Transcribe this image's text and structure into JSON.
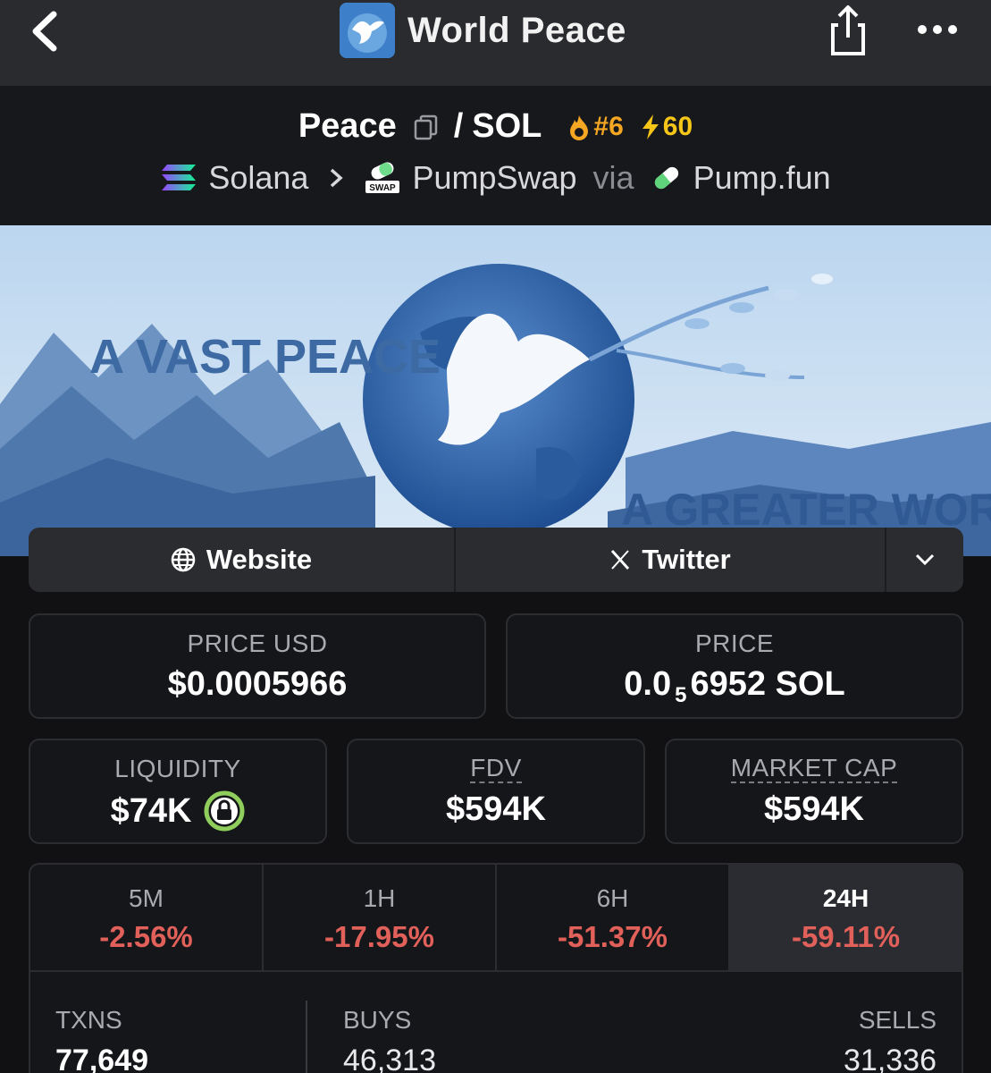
{
  "nav": {
    "title": "World Peace",
    "icons": [
      "back-chevron-icon",
      "token-logo",
      "share-icon",
      "more-dots-icon"
    ]
  },
  "pair": {
    "base": "Peace",
    "slash": "/",
    "quote": "SOL",
    "rank": "#6",
    "boost": "60",
    "chain": "Solana",
    "dex": "PumpSwap",
    "via": "via",
    "launchpad": "Pump.fun"
  },
  "banner": {
    "text_left": "A VAST PEACE",
    "text_right": "A GREATER WORLD"
  },
  "links": {
    "website": "Website",
    "twitter": "Twitter"
  },
  "stats": {
    "price_usd_label": "PRICE USD",
    "price_usd": "$0.0005966",
    "price_label": "PRICE",
    "price_sol_prefix": "0.0",
    "price_sol_sub": "5",
    "price_sol_suffix": "6952 SOL",
    "liquidity_label": "LIQUIDITY",
    "liquidity": "$74K",
    "fdv_label": "FDV",
    "fdv": "$594K",
    "mcap_label": "MARKET CAP",
    "mcap": "$594K"
  },
  "timeframes": [
    {
      "label": "5M",
      "change": "-2.56%"
    },
    {
      "label": "1H",
      "change": "-17.95%"
    },
    {
      "label": "6H",
      "change": "-51.37%"
    },
    {
      "label": "24H",
      "change": "-59.11%"
    }
  ],
  "txns": {
    "txns_label": "TXNS",
    "txns": "77,649",
    "buys_label": "BUYS",
    "buys": "46,313",
    "sells_label": "SELLS",
    "sells": "31,336"
  },
  "colors": {
    "negative": "#e2605a",
    "rank": "#f5a623",
    "boost": "#f5c518",
    "lock": "#8fce5c"
  }
}
